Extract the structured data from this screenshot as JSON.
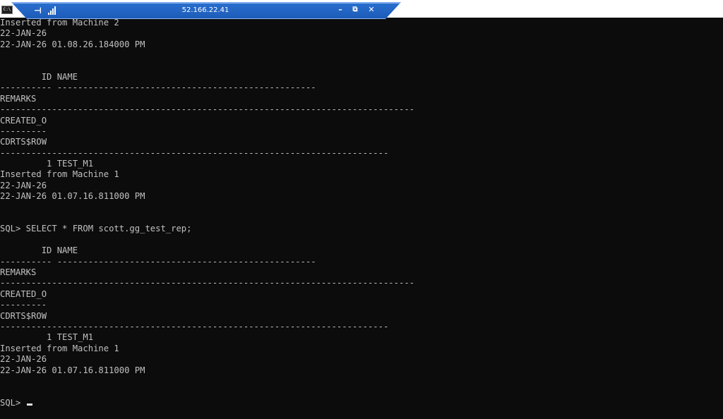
{
  "window": {
    "app_icon_label": "C:\\",
    "host": "52.166.22.41",
    "buttons": {
      "minimize": "–",
      "restore": "⧉",
      "close": "✕"
    }
  },
  "console": {
    "lines": [
      "Inserted from Machine 2",
      "22-JAN-26",
      "22-JAN-26 01.08.26.184000 PM",
      "",
      "",
      "        ID NAME",
      "---------- --------------------------------------------------",
      "REMARKS",
      "--------------------------------------------------------------------------------",
      "CREATED_O",
      "---------",
      "CDRTS$ROW",
      "---------------------------------------------------------------------------",
      "         1 TEST_M1",
      "Inserted from Machine 1",
      "22-JAN-26",
      "22-JAN-26 01.07.16.811000 PM",
      "",
      "",
      "SQL> SELECT * FROM scott.gg_test_rep;",
      "",
      "        ID NAME",
      "---------- --------------------------------------------------",
      "REMARKS",
      "--------------------------------------------------------------------------------",
      "CREATED_O",
      "---------",
      "CDRTS$ROW",
      "---------------------------------------------------------------------------",
      "         1 TEST_M1",
      "Inserted from Machine 1",
      "22-JAN-26",
      "22-JAN-26 01.07.16.811000 PM",
      "",
      "",
      "SQL> "
    ]
  }
}
